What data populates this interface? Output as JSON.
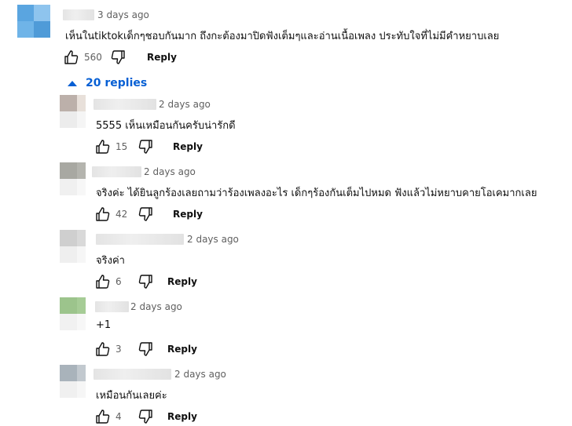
{
  "main_comment": {
    "timestamp": "3 days ago",
    "text": "เห็นในtiktokเด็กๆชอบกันมาก ถึงกะต้องมาปิดฟังเต็มๆและอ่านเนื้อเพลง ประทับใจที่ไม่มีคำหยาบเลย",
    "likes": "560",
    "reply_label": "Reply",
    "avatar_colors": [
      "#5aa5e0",
      "#8ec4ee",
      "#6fb4e8",
      "#4f9bd8"
    ]
  },
  "replies_toggle": {
    "label": "20 replies",
    "icon": "caret-up-icon"
  },
  "replies": [
    {
      "timestamp": "2 days ago",
      "text": "5555 เห็นเหมือนกันครับน่ารักดี",
      "likes": "15",
      "reply_label": "Reply",
      "avatar_colors": [
        "#bcb0aa",
        "#e8e0da",
        "#ececec",
        "#f5f5f5"
      ]
    },
    {
      "timestamp": "2 days ago",
      "text": "จริงค่ะ ได้ยินลูกร้องเลยถามว่าร้องเพลงอะไร เด็กๆร้องกันเต็มไปหมด ฟังแล้วไม่หยาบคายโอเคมากเลย",
      "likes": "42",
      "reply_label": "Reply",
      "avatar_colors": [
        "#a8a8a2",
        "#b4b4ae",
        "#f0f0f0",
        "#f7f7f7"
      ]
    },
    {
      "timestamp": "2 days ago",
      "text": "จริงค่า",
      "likes": "6",
      "reply_label": "Reply",
      "avatar_colors": [
        "#cfcfcf",
        "#d9d9d9",
        "#efefef",
        "#f6f6f6"
      ]
    },
    {
      "timestamp": "2 days ago",
      "text": "+1",
      "likes": "3",
      "reply_label": "Reply",
      "avatar_colors": [
        "#9cc48c",
        "#a6cc96",
        "#f1f1f1",
        "#f7f7f7"
      ]
    },
    {
      "timestamp": "2 days ago",
      "text": "เหมือนกันเลยค่ะ",
      "likes": "4",
      "reply_label": "Reply",
      "avatar_colors": [
        "#a9b3bb",
        "#c2c9cf",
        "#f0f0f0",
        "#f6f6f6"
      ]
    }
  ],
  "icons": {
    "like": "thumbs-up-icon",
    "dislike": "thumbs-down-icon"
  }
}
